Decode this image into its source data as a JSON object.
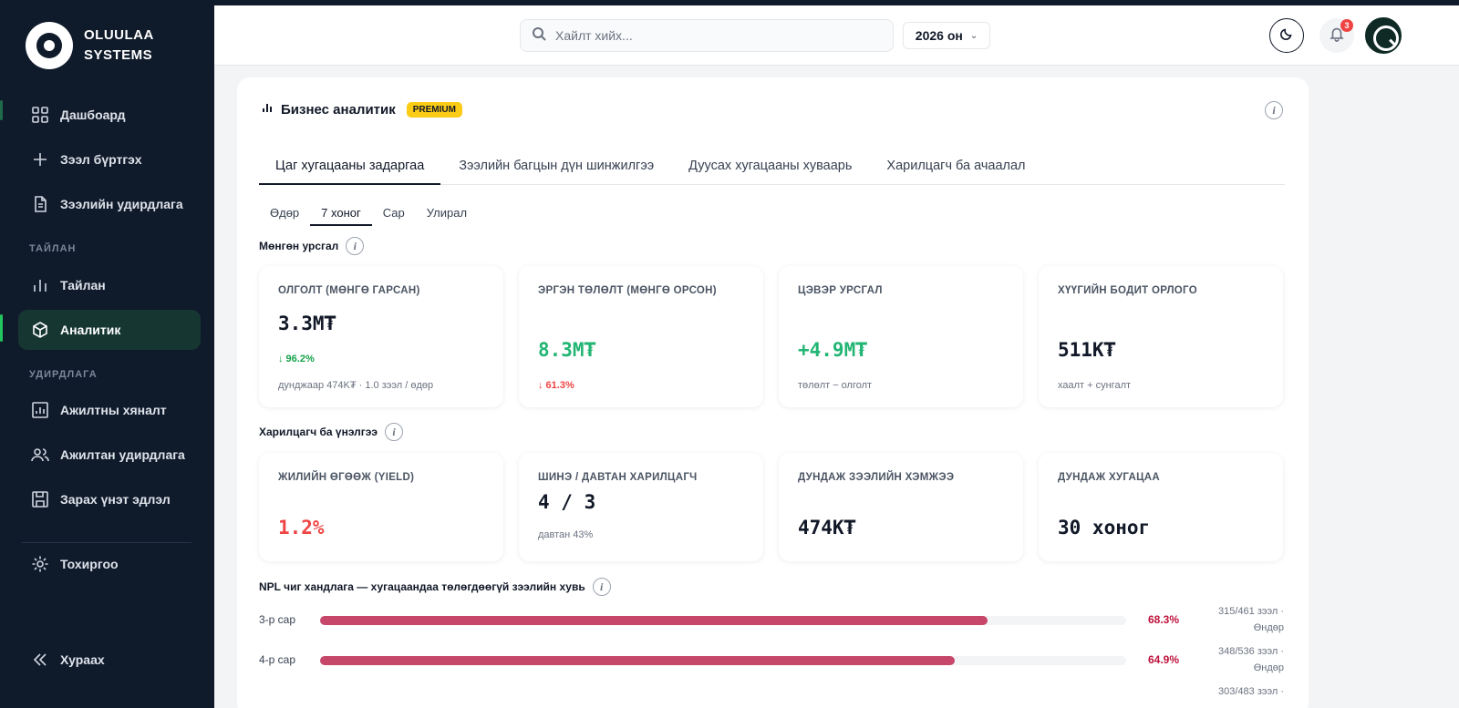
{
  "brand": {
    "line1": "OLUULAA",
    "line2": "SYSTEMS"
  },
  "sidebar": {
    "items": [
      {
        "label": "Дашбоард",
        "icon": "grid-icon"
      },
      {
        "label": "Зээл бүртгэх",
        "icon": "plus-icon"
      },
      {
        "label": "Зээлийн удирдлага",
        "icon": "document-icon"
      },
      {
        "label": "Тайлан",
        "icon": "bar-chart-icon"
      },
      {
        "label": "Аналитик",
        "icon": "cube-icon",
        "active": true
      },
      {
        "label": "Ажилтны хяналт",
        "icon": "chart-box-icon"
      },
      {
        "label": "Ажилтан удирдлага",
        "icon": "users-icon"
      },
      {
        "label": "Зарах үнэт эдлэл",
        "icon": "save-icon"
      },
      {
        "label": "Тохиргоо",
        "icon": "gear-icon"
      },
      {
        "label": "Хураах",
        "icon": "double-chevron-left-icon"
      }
    ],
    "sections": {
      "report": "ТАЙЛАН",
      "management": "УДИРДЛАГА"
    }
  },
  "topbar": {
    "search_placeholder": "Хайлт хийх...",
    "year": "2026 он",
    "notification_count": "3"
  },
  "card": {
    "title": "Бизнес аналитик",
    "premium": "PREMIUM",
    "tabs": [
      "Цаг хугацааны задаргаа",
      "Зээлийн багцын дүн шинжилгээ",
      "Дуусах хугацааны хуваарь",
      "Харилцагч ба ачаалал"
    ],
    "subtabs": [
      "Өдөр",
      "7 хоног",
      "Сар",
      "Улирал"
    ],
    "cashflow_title": "Мөнгөн урсгал",
    "cashflow": [
      {
        "label": "ОЛГОЛТ (МӨНГӨ ГАРСАН)",
        "value": "3.3M₮",
        "change": "↓ 96.2%",
        "note": "дунджаар 474K₮ · 1.0 зээл / өдөр"
      },
      {
        "label": "ЭРГЭН ТӨЛӨЛТ (МӨНГӨ ОРСОН)",
        "value": "8.3M₮",
        "change": "↓ 61.3%"
      },
      {
        "label": "ЦЭВЭР УРСГАЛ",
        "value": "+4.9M₮",
        "note": "төлөлт − олголт"
      },
      {
        "label": "ХҮҮГИЙН БОДИТ ОРЛОГО",
        "value": "511K₮",
        "note": "хаалт + сунгалт"
      }
    ],
    "customer_title": "Харилцагч ба үнэлгээ",
    "customer": [
      {
        "label": "ЖИЛИЙН ӨГӨӨЖ (YIELD)",
        "value": "1.2%"
      },
      {
        "label": "ШИНЭ / ДАВТАН ХАРИЛЦАГЧ",
        "value": "4 / 3",
        "note": "давтан 43%"
      },
      {
        "label": "ДУНДАЖ ЗЭЭЛИЙН ХЭМЖЭЭ",
        "value": "474K₮"
      },
      {
        "label": "ДУНДАЖ ХУГАЦАА",
        "value": "30 хоног"
      }
    ],
    "npl_title": "NPL чиг хандлага — хугацаандаа төлөгдөөгүй зээлийн хувь",
    "npl": [
      {
        "label": "3-р сар",
        "pct": "68.3%",
        "ratio": 0.828,
        "detail1": "315/461 зээл ·",
        "detail2": "Өндөр"
      },
      {
        "label": "4-р сар",
        "pct": "64.9%",
        "ratio": 0.787,
        "detail1": "348/536 зээл ·",
        "detail2": "Өндөр"
      },
      {
        "label": "",
        "pct": "",
        "ratio": 0,
        "detail1": "303/483 зээл ·",
        "detail2": ""
      }
    ]
  },
  "colors": {
    "sidebar_bg": "#0f1a2b",
    "accent_green": "#22b573",
    "danger_red": "#ef4444",
    "npl_bar": "#c6476a",
    "premium_yellow": "#facc15"
  }
}
